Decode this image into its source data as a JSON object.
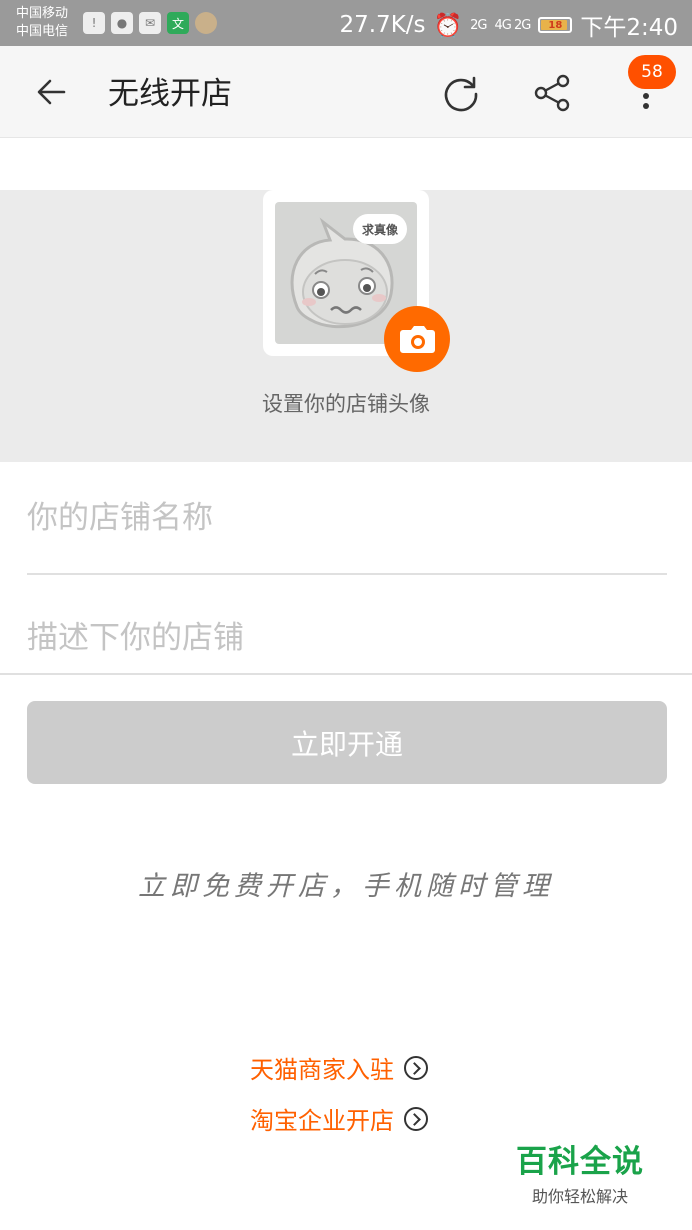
{
  "status_bar": {
    "carrier_1": "中国移动",
    "carrier_2": "中国电信",
    "speed": "27.7K/s",
    "network_1": "2G",
    "network_2": "4G 2G",
    "battery": "18",
    "time": "下午2:40",
    "icons": [
      "alert-icon",
      "wechat-icon",
      "mail-icon",
      "translate-icon",
      "app-avatar-icon",
      "alarm-icon"
    ]
  },
  "app_bar": {
    "title": "无线开店",
    "badge_count": "58",
    "icons": [
      "back-arrow-icon",
      "refresh-icon",
      "share-icon",
      "more-icon"
    ]
  },
  "avatar": {
    "bubble_text": "求真像",
    "label": "设置你的店铺头像",
    "camera_icon": "camera-icon"
  },
  "form": {
    "name_placeholder": "你的店铺名称",
    "name_value": "",
    "desc_placeholder": "描述下你的店铺",
    "desc_value": "",
    "submit_label": "立即开通"
  },
  "slogan": "立即免费开店，手机随时管理",
  "links": {
    "tmall": "天猫商家入驻",
    "taobao": "淘宝企业开店"
  },
  "watermark": {
    "title": "百科全说",
    "subtitle": "助你轻松解决"
  },
  "colors": {
    "accent": "#ff6000",
    "badge": "#ff5000",
    "button_disabled": "#cccccc",
    "watermark": "#1aa34a"
  }
}
